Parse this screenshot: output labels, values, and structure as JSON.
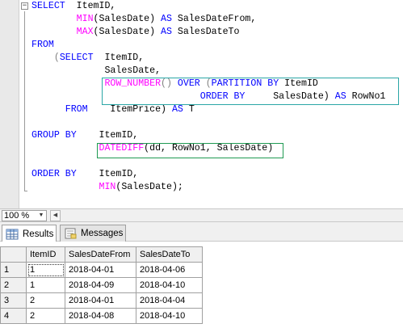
{
  "editor": {
    "lines": [
      [
        {
          "t": "SELECT ",
          "c": "kw"
        },
        {
          "t": " ItemID,",
          "c": "plain"
        }
      ],
      [
        {
          "t": "        ",
          "c": "plain"
        },
        {
          "t": "MIN",
          "c": "fn"
        },
        {
          "t": "(SalesDate) ",
          "c": "plain"
        },
        {
          "t": "AS",
          "c": "kw"
        },
        {
          "t": " SalesDateFrom,",
          "c": "plain"
        }
      ],
      [
        {
          "t": "        ",
          "c": "plain"
        },
        {
          "t": "MAX",
          "c": "fn"
        },
        {
          "t": "(SalesDate) ",
          "c": "plain"
        },
        {
          "t": "AS",
          "c": "kw"
        },
        {
          "t": " SalesDateTo",
          "c": "plain"
        }
      ],
      [
        {
          "t": "FROM",
          "c": "kw"
        }
      ],
      [
        {
          "t": "    ",
          "c": "plain"
        },
        {
          "t": "(",
          "c": "gray"
        },
        {
          "t": "SELECT",
          "c": "kw"
        },
        {
          "t": "  ItemID,",
          "c": "plain"
        }
      ],
      [
        {
          "t": "             SalesDate,",
          "c": "plain"
        }
      ],
      [
        {
          "t": "             ",
          "c": "plain"
        },
        {
          "t": "ROW_NUMBER",
          "c": "fn"
        },
        {
          "t": "() ",
          "c": "gray"
        },
        {
          "t": "OVER",
          "c": "kw"
        },
        {
          "t": " (",
          "c": "gray"
        },
        {
          "t": "PARTITION BY",
          "c": "kw"
        },
        {
          "t": " ItemID",
          "c": "plain"
        }
      ],
      [
        {
          "t": "                              ",
          "c": "plain"
        },
        {
          "t": "ORDER BY",
          "c": "kw"
        },
        {
          "t": "     SalesDate) ",
          "c": "plain"
        },
        {
          "t": "AS",
          "c": "kw"
        },
        {
          "t": " RowNo1",
          "c": "plain"
        }
      ],
      [
        {
          "t": "      ",
          "c": "plain"
        },
        {
          "t": "FROM",
          "c": "kw"
        },
        {
          "t": "    ItemPrice) ",
          "c": "plain"
        },
        {
          "t": "AS",
          "c": "kw"
        },
        {
          "t": " T",
          "c": "plain"
        }
      ],
      [],
      [
        {
          "t": "GROUP BY",
          "c": "kw"
        },
        {
          "t": "    ItemID,",
          "c": "plain"
        }
      ],
      [
        {
          "t": "            ",
          "c": "plain"
        },
        {
          "t": "DATEDIFF",
          "c": "fn"
        },
        {
          "t": "(dd, RowNo1, SalesDate)",
          "c": "plain"
        }
      ],
      [],
      [
        {
          "t": "ORDER BY",
          "c": "kw"
        },
        {
          "t": "    ItemID,",
          "c": "plain"
        }
      ],
      [
        {
          "t": "            ",
          "c": "plain"
        },
        {
          "t": "MIN",
          "c": "fn"
        },
        {
          "t": "(SalesDate);",
          "c": "plain"
        }
      ]
    ],
    "highlight_color_row_number": "#2aa6a6",
    "highlight_color_datediff": "#1f9a52",
    "keyword_color": "#0000ff",
    "function_color": "#ff00ff"
  },
  "zoom": {
    "value": "100 %"
  },
  "tabs": [
    {
      "label": "Results",
      "icon": "results-grid-icon",
      "active": true
    },
    {
      "label": "Messages",
      "icon": "messages-icon",
      "active": false
    }
  ],
  "grid": {
    "columns": [
      "ItemID",
      "SalesDateFrom",
      "SalesDateTo"
    ],
    "rows": [
      {
        "num": "1",
        "cells": [
          "1",
          "2018-04-01",
          "2018-04-06"
        ]
      },
      {
        "num": "2",
        "cells": [
          "1",
          "2018-04-09",
          "2018-04-10"
        ]
      },
      {
        "num": "3",
        "cells": [
          "2",
          "2018-04-01",
          "2018-04-04"
        ]
      },
      {
        "num": "4",
        "cells": [
          "2",
          "2018-04-08",
          "2018-04-10"
        ]
      }
    ]
  }
}
